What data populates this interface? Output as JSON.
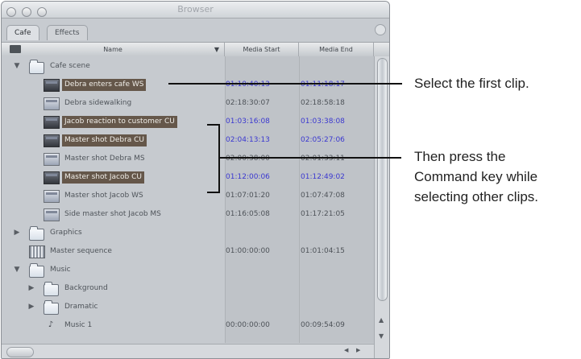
{
  "window": {
    "title": "Browser"
  },
  "tabs": [
    {
      "label": "Cafe",
      "active": true
    },
    {
      "label": "Effects",
      "active": false
    }
  ],
  "columns": {
    "name": "Name",
    "media_start": "Media Start",
    "media_end": "Media End"
  },
  "rows": [
    {
      "name": "Cafe scene",
      "type": "folder",
      "expanded": true,
      "start": "",
      "end": ""
    },
    {
      "name": "Debra enters cafe WS",
      "type": "clip",
      "selected": true,
      "start": "01:10:40:13",
      "end": "01:11:18:17"
    },
    {
      "name": "Debra sidewalking",
      "type": "clip",
      "selected": false,
      "start": "02:18:30:07",
      "end": "02:18:58:18"
    },
    {
      "name": "Jacob reaction to customer CU",
      "type": "clip",
      "selected": true,
      "start": "01:03:16:08",
      "end": "01:03:38:08"
    },
    {
      "name": "Master shot Debra CU",
      "type": "clip",
      "selected": true,
      "start": "02:04:13:13",
      "end": "02:05:27:06"
    },
    {
      "name": "Master shot Debra MS",
      "type": "clip",
      "selected": false,
      "start": "02:00:38:00",
      "end": "02:01:33:11"
    },
    {
      "name": "Master shot Jacob CU",
      "type": "clip",
      "selected": true,
      "start": "01:12:00:06",
      "end": "01:12:49:02"
    },
    {
      "name": "Master shot Jacob WS",
      "type": "clip",
      "selected": false,
      "start": "01:07:01:20",
      "end": "01:07:47:08"
    },
    {
      "name": "Side master shot Jacob MS",
      "type": "clip",
      "selected": false,
      "start": "01:16:05:08",
      "end": "01:17:21:05"
    },
    {
      "name": "Graphics",
      "type": "folder",
      "expanded": false,
      "start": "",
      "end": ""
    },
    {
      "name": "Master sequence",
      "type": "sequence",
      "start": "01:00:00:00",
      "end": "01:01:04:15"
    },
    {
      "name": "Music",
      "type": "folder",
      "expanded": true,
      "start": "",
      "end": ""
    },
    {
      "name": "Background",
      "type": "folder",
      "expanded": false,
      "start": "",
      "end": ""
    },
    {
      "name": "Dramatic",
      "type": "folder",
      "expanded": false,
      "start": "",
      "end": ""
    },
    {
      "name": "Music 1",
      "type": "music",
      "start": "00:00:00:00",
      "end": "00:09:54:09"
    }
  ],
  "callouts": {
    "first": "Select the first clip.",
    "second_lines": [
      "Then press the",
      "Command key while",
      "selecting other clips."
    ]
  },
  "colors": {
    "selection": "#65574a",
    "timecode_selected": "#3b38d0",
    "window_bg": "#c5c9ce"
  }
}
